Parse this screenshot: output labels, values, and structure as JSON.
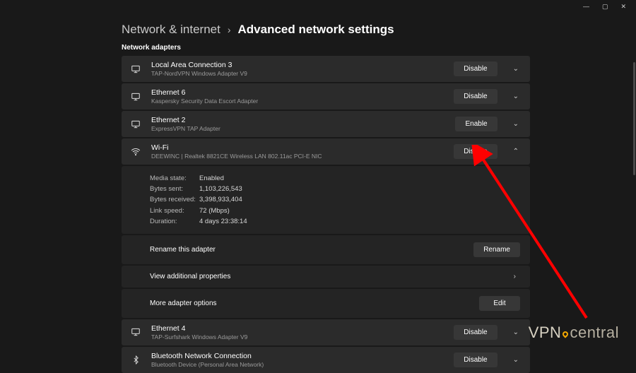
{
  "window": {
    "minimize": "—",
    "maximize": "▢",
    "close": "✕"
  },
  "breadcrumb": {
    "parent": "Network & internet",
    "current": "Advanced network settings"
  },
  "section_heading": "Network adapters",
  "adapters": [
    {
      "name": "Local Area Connection 3",
      "desc": "TAP-NordVPN Windows Adapter V9",
      "button": "Disable",
      "expanded": false,
      "icon": "monitor"
    },
    {
      "name": "Ethernet 6",
      "desc": "Kaspersky Security Data Escort Adapter",
      "button": "Disable",
      "expanded": false,
      "icon": "monitor"
    },
    {
      "name": "Ethernet 2",
      "desc": "ExpressVPN TAP Adapter",
      "button": "Enable",
      "expanded": false,
      "icon": "monitor"
    },
    {
      "name": "Wi-Fi",
      "desc": "DEEWINC | Realtek 8821CE Wireless LAN 802.11ac PCI-E NIC",
      "button": "Disable",
      "expanded": true,
      "icon": "wifi"
    },
    {
      "name": "Ethernet 4",
      "desc": "TAP-Surfshark Windows Adapter V9",
      "button": "Disable",
      "expanded": false,
      "icon": "monitor"
    },
    {
      "name": "Bluetooth Network Connection",
      "desc": "Bluetooth Device (Personal Area Network)",
      "button": "Disable",
      "expanded": false,
      "icon": "bluetooth"
    }
  ],
  "wifi_details": {
    "rows": [
      {
        "label": "Media state:",
        "value": "Enabled"
      },
      {
        "label": "Bytes sent:",
        "value": "1,103,226,543"
      },
      {
        "label": "Bytes received:",
        "value": "3,398,933,404"
      },
      {
        "label": "Link speed:",
        "value": "72 (Mbps)"
      },
      {
        "label": "Duration:",
        "value": "4 days 23:38:14"
      }
    ],
    "rename_label": "Rename this adapter",
    "rename_button": "Rename",
    "view_props_label": "View additional properties",
    "more_options_label": "More adapter options",
    "more_options_button": "Edit"
  },
  "watermark": {
    "part1": "VPN",
    "part2": "central"
  }
}
